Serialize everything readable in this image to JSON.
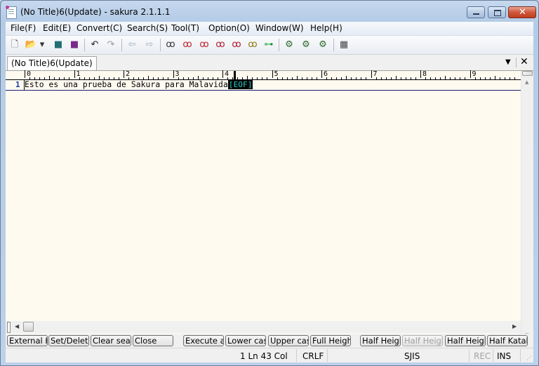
{
  "window": {
    "title": "(No Title)6(Update) - sakura 2.1.1.1",
    "icons": {
      "app": "notepad-icon",
      "minimize": "minimize-icon",
      "maximize": "maximize-icon",
      "close": "close-icon"
    },
    "close_glyph": "✕"
  },
  "menu": [
    "File(F)",
    "Edit(E)",
    "Convert(C)",
    "Search(S)",
    "Tool(T)",
    "Option(O)",
    "Window(W)",
    "Help(H)"
  ],
  "toolbar": {
    "buttons": [
      {
        "name": "new-file",
        "glyph": "🗋",
        "color": "#555555"
      },
      {
        "name": "open-file",
        "glyph": "📂",
        "color": "#b38a1e"
      },
      {
        "name": "open-dropdown",
        "glyph": "▾",
        "color": "#333333"
      },
      {
        "name": "save",
        "glyph": "■",
        "color": "#1f6f73"
      },
      {
        "name": "save-as",
        "glyph": "■",
        "color": "#7a2a8a"
      },
      {
        "name": "undo",
        "glyph": "↶",
        "color": "#222222"
      },
      {
        "name": "redo",
        "glyph": "↷",
        "color": "#9a9a9a"
      },
      {
        "name": "move-back",
        "glyph": "⇦",
        "color": "#9fb0c0"
      },
      {
        "name": "move-forward",
        "glyph": "⇨",
        "color": "#9fb0c0"
      },
      {
        "name": "search",
        "glyph": "ꝏ",
        "color": "#333333"
      },
      {
        "name": "search-next",
        "glyph": "ꝏ",
        "color": "#c0202a"
      },
      {
        "name": "search-prev",
        "glyph": "ꝏ",
        "color": "#c0202a"
      },
      {
        "name": "replace",
        "glyph": "ꝏ",
        "color": "#b01b2a"
      },
      {
        "name": "clear-search-mark",
        "glyph": "ꝏ",
        "color": "#b01b2a"
      },
      {
        "name": "grep",
        "glyph": "ꝏ",
        "color": "#8a7a10"
      },
      {
        "name": "outline",
        "glyph": "⊶",
        "color": "#1a9a3a"
      },
      {
        "name": "common-settings",
        "glyph": "⚙",
        "color": "#2a6a2a"
      },
      {
        "name": "type-settings",
        "glyph": "⚙",
        "color": "#2a6a2a"
      },
      {
        "name": "font-settings",
        "glyph": "⚙",
        "color": "#2a6a2a"
      },
      {
        "name": "window-list",
        "glyph": "▦",
        "color": "#444444"
      }
    ]
  },
  "tabs": {
    "items": [
      {
        "label": "(No Title)6(Update)"
      }
    ],
    "dropdown_glyph": "▼",
    "close_glyph": "✕"
  },
  "editor": {
    "ruler_labels": [
      "0",
      "1",
      "2",
      "3",
      "4",
      "5",
      "6",
      "7",
      "8",
      "9"
    ],
    "lines": [
      {
        "number": "1",
        "text": "Esto es una prueba de Sakura para Malavida",
        "eof": "[EOF]"
      }
    ],
    "background": "#fffaf0",
    "eof_color": "#29d1c7"
  },
  "scrollbars": {
    "up_glyph": "▲",
    "down_glyph": "▼",
    "left_glyph": "◀",
    "right_glyph": "▶"
  },
  "function_keys": [
    {
      "label": "External H",
      "enabled": true
    },
    {
      "label": "Set/Delete",
      "enabled": true
    },
    {
      "label": "Clear sear",
      "enabled": true
    },
    {
      "label": "Close",
      "enabled": true
    },
    {
      "label": "Execute ar",
      "enabled": true
    },
    {
      "label": "Lower case",
      "enabled": true
    },
    {
      "label": "Upper case",
      "enabled": true
    },
    {
      "label": "Full Heigh",
      "enabled": true
    },
    {
      "label": "Half Heigh",
      "enabled": true
    },
    {
      "label": "Half Heigh",
      "enabled": false
    },
    {
      "label": "Half Heigh",
      "enabled": true
    },
    {
      "label": "Half Katak",
      "enabled": true
    }
  ],
  "status": {
    "position": "1 Ln   43 Col",
    "line_ending": "CRLF",
    "encoding": "SJIS",
    "rec": "REC",
    "insert_mode": "INS",
    "grip_glyph": "⋰"
  }
}
